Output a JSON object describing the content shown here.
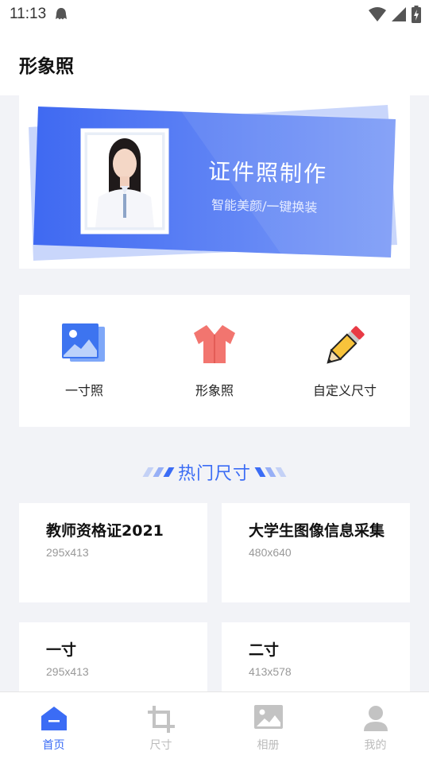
{
  "status_bar": {
    "time": "11:13"
  },
  "header": {
    "title": "形象照"
  },
  "banner": {
    "title": "证件照制作",
    "subtitle": "智能美颜/一键换装"
  },
  "features": [
    {
      "label": "一寸照",
      "icon": "photo-gallery-icon"
    },
    {
      "label": "形象照",
      "icon": "shirt-icon"
    },
    {
      "label": "自定义尺寸",
      "icon": "pencil-icon"
    }
  ],
  "section": {
    "title": "热门尺寸"
  },
  "sizes": [
    {
      "name": "教师资格证2021",
      "dims": "295x413"
    },
    {
      "name": "大学生图像信息采集",
      "dims": "480x640"
    },
    {
      "name": "一寸",
      "dims": "295x413"
    },
    {
      "name": "二寸",
      "dims": "413x578"
    }
  ],
  "nav": [
    {
      "label": "首页",
      "icon": "home-icon",
      "active": true
    },
    {
      "label": "尺寸",
      "icon": "crop-icon",
      "active": false
    },
    {
      "label": "相册",
      "icon": "album-icon",
      "active": false
    },
    {
      "label": "我的",
      "icon": "profile-icon",
      "active": false
    }
  ],
  "colors": {
    "accent": "#3b6cf5",
    "background": "#f2f3f7"
  }
}
